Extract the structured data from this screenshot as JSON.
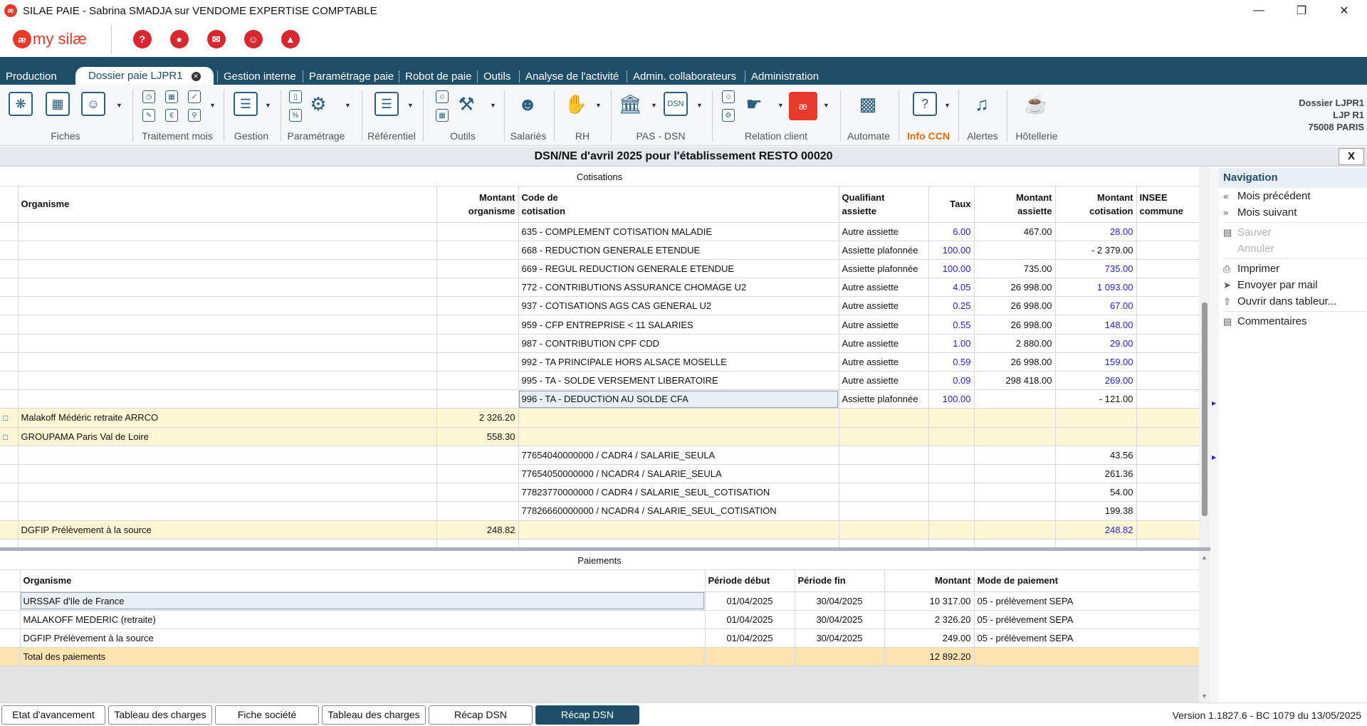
{
  "window": {
    "title": "SILAE PAIE - Sabrina SMADJA sur VENDOME EXPERTISE COMPTABLE"
  },
  "menu": {
    "items": [
      {
        "label": "Production"
      },
      {
        "label": "Dossier paie LJPR1",
        "active": true
      },
      {
        "label": "Gestion interne"
      },
      {
        "label": "Paramétrage paie"
      },
      {
        "label": "Robot de paie"
      },
      {
        "label": "Outils"
      },
      {
        "label": "Analyse de l'activité"
      },
      {
        "label": "Admin. collaborateurs"
      },
      {
        "label": "Administration"
      }
    ]
  },
  "ribbon": {
    "groups": [
      "Fiches",
      "Traitement mois",
      "Gestion",
      "Paramétrage",
      "Référentiel",
      "Outils",
      "Salariés",
      "RH",
      "PAS - DSN",
      "Relation client",
      "Automate",
      "Info CCN",
      "Alertes",
      "Hôtellerie"
    ],
    "dsn_icon_text": "DSN"
  },
  "dossier": {
    "line1": "Dossier LJPR1",
    "line2": "LJP R1",
    "line3": "75008 PARIS"
  },
  "dsn_title": "DSN/NE d'avril 2025 pour l'établissement RESTO 00020",
  "close_label": "X",
  "cotisations": {
    "section_title": "Cotisations",
    "headers": {
      "organisme": "Organisme",
      "montant_org_1": "Montant",
      "montant_org_2": "organisme",
      "code_1": "Code de",
      "code_2": "cotisation",
      "qualif_1": "Qualifiant",
      "qualif_2": "assiette",
      "taux": "Taux",
      "massiette_1": "Montant",
      "massiette_2": "assiette",
      "mcotis_1": "Montant",
      "mcotis_2": "cotisation",
      "insee_1": "INSEE",
      "insee_2": "commune"
    },
    "rows": [
      {
        "type": "line",
        "organisme": "",
        "montant_org": "",
        "code": "635 - COMPLEMENT COTISATION MALADIE",
        "qualif": "Autre assiette",
        "taux": "6.00",
        "assiette": "467.00",
        "cotisation": "28.00",
        "blue": true
      },
      {
        "type": "line",
        "organisme": "",
        "montant_org": "",
        "code": "668 - REDUCTION GENERALE ETENDUE",
        "qualif": "Assiette plafonnée",
        "taux": "100.00",
        "assiette": "",
        "cotisation": "- 2 379.00",
        "blue": false
      },
      {
        "type": "line",
        "organisme": "",
        "montant_org": "",
        "code": "669 - REGUL REDUCTION GENERALE ETENDUE",
        "qualif": "Assiette plafonnée",
        "taux": "100.00",
        "assiette": "735.00",
        "cotisation": "735.00",
        "blue": true
      },
      {
        "type": "line",
        "organisme": "",
        "montant_org": "",
        "code": "772 - CONTRIBUTIONS ASSURANCE CHOMAGE U2",
        "qualif": "Autre assiette",
        "taux": "4.05",
        "assiette": "26 998.00",
        "cotisation": "1 093.00",
        "blue": true
      },
      {
        "type": "line",
        "organisme": "",
        "montant_org": "",
        "code": "937 - COTISATIONS AGS CAS GENERAL U2",
        "qualif": "Autre assiette",
        "taux": "0.25",
        "assiette": "26 998.00",
        "cotisation": "67.00",
        "blue": true
      },
      {
        "type": "line",
        "organisme": "",
        "montant_org": "",
        "code": "959 - CFP ENTREPRISE < 11 SALARIES",
        "qualif": "Autre assiette",
        "taux": "0.55",
        "assiette": "26 998.00",
        "cotisation": "148.00",
        "blue": true
      },
      {
        "type": "line",
        "organisme": "",
        "montant_org": "",
        "code": "987 - CONTRIBUTION CPF CDD",
        "qualif": "Autre assiette",
        "taux": "1.00",
        "assiette": "2 880.00",
        "cotisation": "29.00",
        "blue": true
      },
      {
        "type": "line",
        "organisme": "",
        "montant_org": "",
        "code": "992 - TA PRINCIPALE HORS ALSACE MOSELLE",
        "qualif": "Autre assiette",
        "taux": "0.59",
        "assiette": "26 998.00",
        "cotisation": "159.00",
        "blue": true
      },
      {
        "type": "line",
        "organisme": "",
        "montant_org": "",
        "code": "995 - TA - SOLDE VERSEMENT LIBERATOIRE",
        "qualif": "Autre assiette",
        "taux": "0.09",
        "assiette": "298 418.00",
        "cotisation": "269.00",
        "blue": true
      },
      {
        "type": "line",
        "organisme": "",
        "montant_org": "",
        "code": "996 - TA - DEDUCTION AU SOLDE CFA",
        "qualif": "Assiette plafonnée",
        "taux": "100.00",
        "assiette": "",
        "cotisation": "- 121.00",
        "blue": false,
        "selected": true
      },
      {
        "type": "org",
        "organisme": "Malakoff Médéric retraite ARRCO",
        "montant_org": "2 326.20",
        "code": "",
        "qualif": "",
        "taux": "",
        "assiette": "",
        "cotisation": "",
        "chat": true
      },
      {
        "type": "org",
        "organisme": "GROUPAMA Paris Val de Loire",
        "montant_org": "558.30",
        "code": "",
        "qualif": "",
        "taux": "",
        "assiette": "",
        "cotisation": "",
        "chat": true
      },
      {
        "type": "line",
        "organisme": "",
        "montant_org": "",
        "code": "77654040000000 / CADR4 / SALARIE_SEULA",
        "qualif": "",
        "taux": "",
        "assiette": "",
        "cotisation": "43.56",
        "blue": false
      },
      {
        "type": "line",
        "organisme": "",
        "montant_org": "",
        "code": "77654050000000 / NCADR4 / SALARIE_SEULA",
        "qualif": "",
        "taux": "",
        "assiette": "",
        "cotisation": "261.36",
        "blue": false
      },
      {
        "type": "line",
        "organisme": "",
        "montant_org": "",
        "code": "77823770000000 / CADR4 / SALARIE_SEUL_COTISATION",
        "qualif": "",
        "taux": "",
        "assiette": "",
        "cotisation": "54.00",
        "blue": false
      },
      {
        "type": "line",
        "organisme": "",
        "montant_org": "",
        "code": "77826660000000 / NCADR4 / SALARIE_SEUL_COTISATION",
        "qualif": "",
        "taux": "",
        "assiette": "",
        "cotisation": "199.38",
        "blue": false
      },
      {
        "type": "org",
        "organisme": "DGFIP Prélèvement à la source",
        "montant_org": "248.82",
        "code": "",
        "qualif": "",
        "taux": "",
        "assiette": "",
        "cotisation": "248.82",
        "blue": true
      }
    ]
  },
  "paiements": {
    "section_title": "Paiements",
    "headers": {
      "organisme": "Organisme",
      "debut": "Période début",
      "fin": "Période fin",
      "montant": "Montant",
      "mode": "Mode de paiement"
    },
    "rows": [
      {
        "organisme": "URSSAF d'Ile de France",
        "debut": "01/04/2025",
        "fin": "30/04/2025",
        "montant": "10 317.00",
        "mode": "05 - prélèvement SEPA",
        "selected": true
      },
      {
        "organisme": "MALAKOFF MEDERIC (retraite)",
        "debut": "01/04/2025",
        "fin": "30/04/2025",
        "montant": "2 326.20",
        "mode": "05 - prélèvement SEPA"
      },
      {
        "organisme": "DGFIP Prélèvement à la source",
        "debut": "01/04/2025",
        "fin": "30/04/2025",
        "montant": "249.00",
        "mode": "05 - prélèvement SEPA"
      }
    ],
    "total": {
      "label": "Total des paiements",
      "montant": "12 892.20"
    }
  },
  "navigation": {
    "title": "Navigation",
    "items": [
      {
        "label": "Mois précédent",
        "icon": "double-chevron-left-icon",
        "disabled": false
      },
      {
        "label": "Mois suivant",
        "icon": "double-chevron-right-icon",
        "disabled": false
      },
      {
        "label": "Sauver",
        "icon": "save-icon",
        "disabled": true
      },
      {
        "label": "Annuler",
        "icon": "",
        "disabled": true
      },
      {
        "label": "Imprimer",
        "icon": "printer-icon",
        "disabled": false
      },
      {
        "label": "Envoyer par mail",
        "icon": "send-icon",
        "disabled": false
      },
      {
        "label": "Ouvrir dans tableur...",
        "icon": "export-icon",
        "disabled": false
      },
      {
        "label": "Commentaires",
        "icon": "comment-icon",
        "disabled": false
      }
    ]
  },
  "bottom_tabs": [
    {
      "label": "Etat d'avancement"
    },
    {
      "label": "Tableau des charges"
    },
    {
      "label": "Fiche société"
    },
    {
      "label": "Tableau des charges"
    },
    {
      "label": "Récap DSN"
    },
    {
      "label": "Récap DSN",
      "active": true
    }
  ],
  "version": "Version 1.1827.6 - BC 1079 du 13/05/2025"
}
